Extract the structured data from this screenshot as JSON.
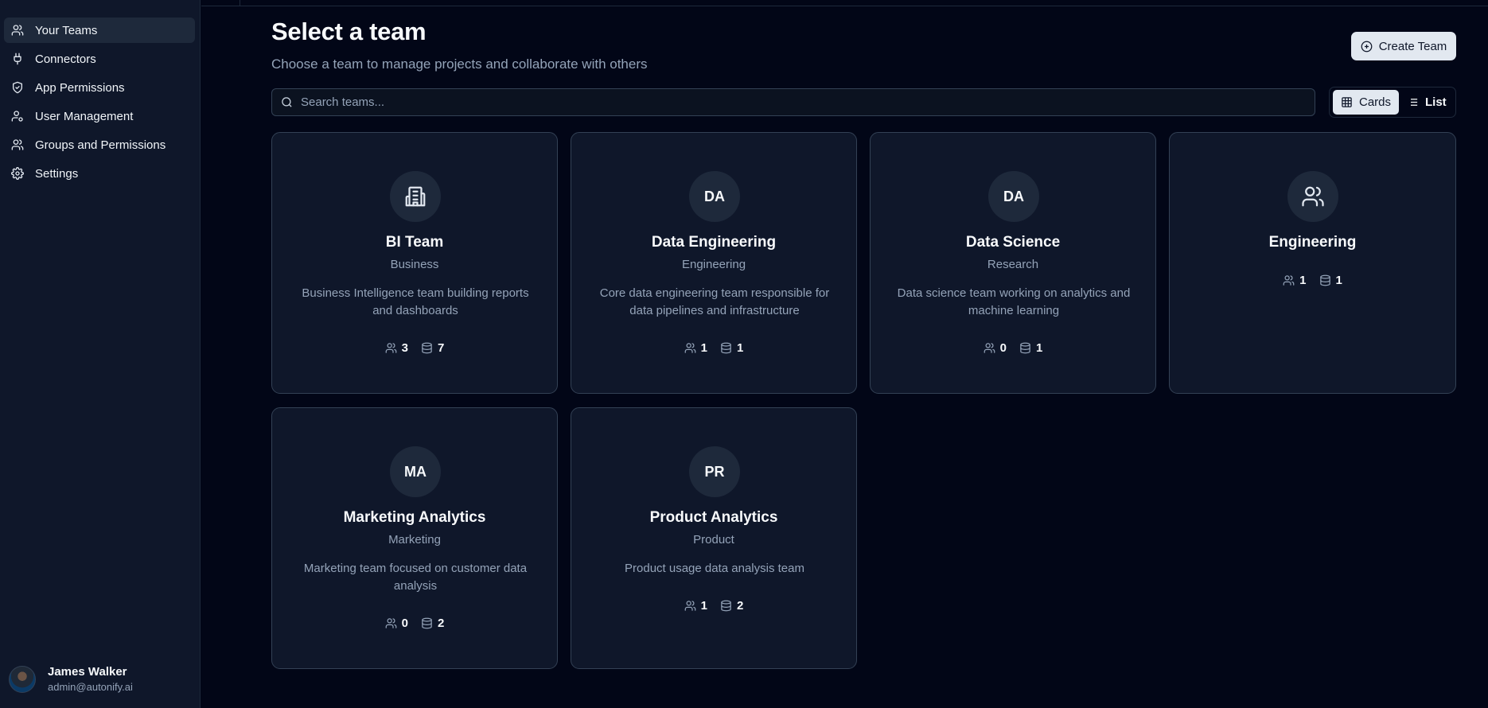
{
  "sidebar": {
    "items": [
      {
        "label": "Your Teams",
        "icon": "users-icon"
      },
      {
        "label": "Connectors",
        "icon": "plug-icon"
      },
      {
        "label": "App Permissions",
        "icon": "shield-icon"
      },
      {
        "label": "User Management",
        "icon": "user-cog-icon"
      },
      {
        "label": "Groups and Permissions",
        "icon": "users-icon"
      },
      {
        "label": "Settings",
        "icon": "gear-icon"
      }
    ],
    "user": {
      "name": "James Walker",
      "email": "admin@autonify.ai"
    }
  },
  "header": {
    "title": "Select a team",
    "subtitle": "Choose a team to manage projects and collaborate with others",
    "create_label": "Create Team"
  },
  "search": {
    "placeholder": "Search teams...",
    "value": ""
  },
  "view_toggle": {
    "cards_label": "Cards",
    "list_label": "List",
    "selected": "Cards"
  },
  "teams": [
    {
      "name": "BI Team",
      "category": "Business",
      "description": "Business Intelligence team building reports and dashboards",
      "members": "3",
      "datasets": "7",
      "icon": "building-icon"
    },
    {
      "name": "Data Engineering",
      "category": "Engineering",
      "description": "Core data engineering team responsible for data pipelines and infrastructure",
      "members": "1",
      "datasets": "1",
      "initials": "DA"
    },
    {
      "name": "Data Science",
      "category": "Research",
      "description": "Data science team working on analytics and machine learning",
      "members": "0",
      "datasets": "1",
      "initials": "DA"
    },
    {
      "name": "Engineering",
      "category": "",
      "description": "",
      "members": "1",
      "datasets": "1",
      "icon": "users-icon"
    },
    {
      "name": "Marketing Analytics",
      "category": "Marketing",
      "description": "Marketing team focused on customer data analysis",
      "members": "0",
      "datasets": "2",
      "initials": "MA"
    },
    {
      "name": "Product Analytics",
      "category": "Product",
      "description": "Product usage data analysis team",
      "members": "1",
      "datasets": "2",
      "initials": "PR"
    }
  ],
  "colors": {
    "background": "#020617",
    "sidebar": "#0f172a",
    "card": "#0f172a",
    "border": "#334155",
    "muted_text": "#94a3b8",
    "button_bg": "#e2e8f0"
  }
}
